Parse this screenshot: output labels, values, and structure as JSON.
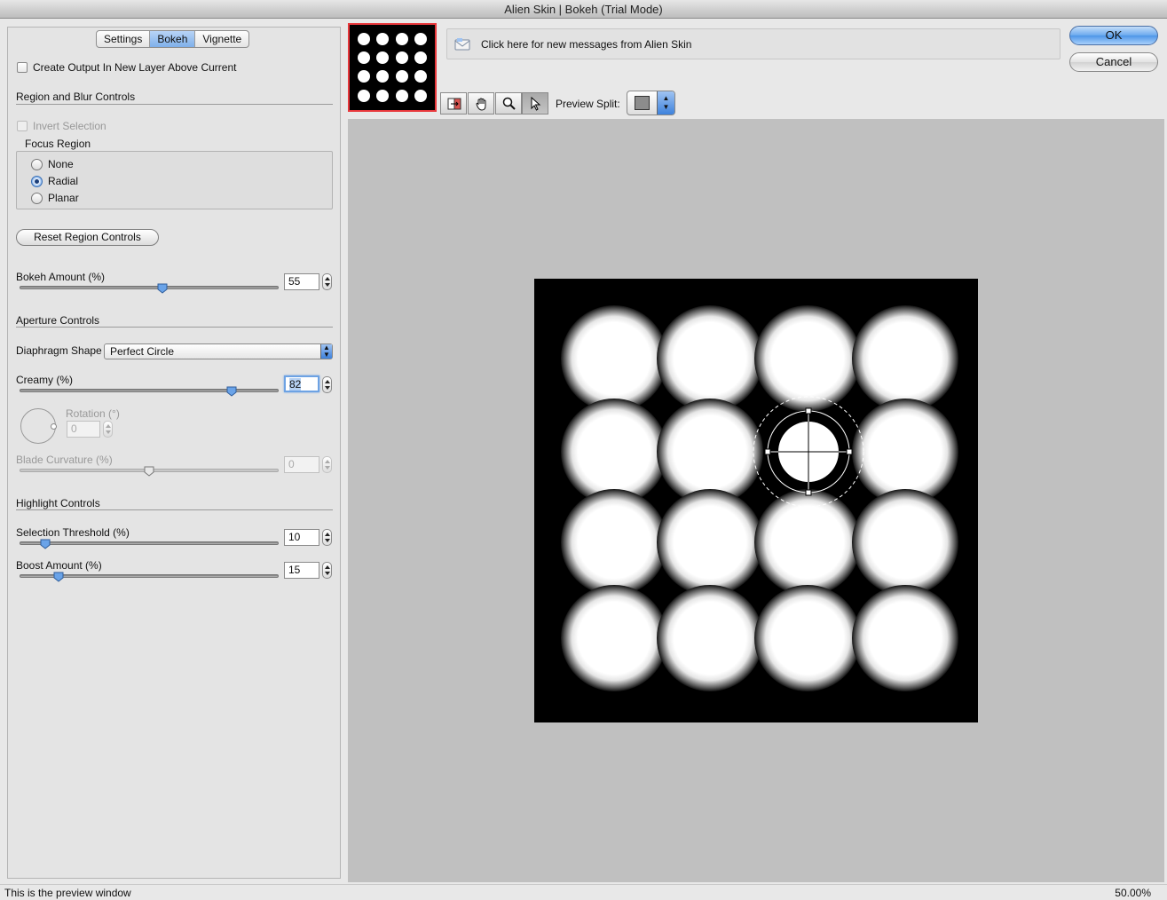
{
  "window": {
    "title": "Alien Skin | Bokeh (Trial Mode)"
  },
  "tabs": [
    "Settings",
    "Bokeh",
    "Vignette"
  ],
  "active_tab": "Bokeh",
  "create_output_label": "Create Output In New Layer Above Current",
  "region": {
    "title": "Region and Blur Controls",
    "invert_label": "Invert Selection",
    "focus_title": "Focus Region",
    "options": [
      "None",
      "Radial",
      "Planar"
    ],
    "selected": "Radial",
    "reset_label": "Reset Region Controls"
  },
  "bokeh_amount": {
    "label": "Bokeh Amount (%)",
    "value": "55",
    "fraction": 0.55
  },
  "aperture": {
    "title": "Aperture Controls",
    "shape_label": "Diaphragm Shape",
    "shape_value": "Perfect Circle",
    "creamy_label": "Creamy (%)",
    "creamy_value": "82",
    "creamy_fraction": 0.82,
    "rotation_label": "Rotation (°)",
    "rotation_value": "0",
    "blade_label": "Blade Curvature (%)",
    "blade_value": "0",
    "blade_fraction": 0.5
  },
  "highlight": {
    "title": "Highlight Controls",
    "threshold_label": "Selection Threshold (%)",
    "threshold_value": "10",
    "threshold_fraction": 0.1,
    "boost_label": "Boost Amount (%)",
    "boost_value": "15",
    "boost_fraction": 0.15
  },
  "messages": {
    "text": "Click here for new messages from Alien Skin"
  },
  "buttons": {
    "ok": "OK",
    "cancel": "Cancel"
  },
  "toolbar": {
    "tools": [
      "compare-icon",
      "hand-icon",
      "zoom-icon",
      "arrow-icon"
    ],
    "active_tool": "arrow-icon",
    "preview_split_label": "Preview Split:"
  },
  "status": {
    "text": "This is the preview window",
    "zoom": "50.00%"
  }
}
